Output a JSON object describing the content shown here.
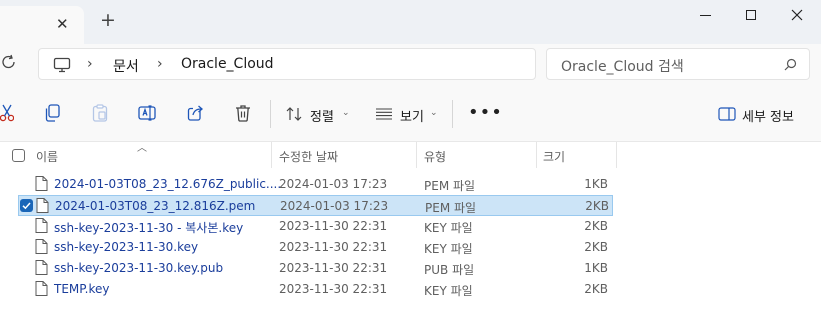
{
  "tabs": {
    "close_glyph": "✕",
    "new_tab_glyph": "+"
  },
  "address": {
    "root_icon": "pc-icon",
    "breadcrumbs": [
      "문서",
      "Oracle_Cloud"
    ],
    "separator": "›"
  },
  "search": {
    "placeholder": "Oracle_Cloud 검색",
    "icon": "search-icon"
  },
  "toolbar": {
    "icons": [
      "cut-icon",
      "copy-icon",
      "paste-icon",
      "rename-icon",
      "share-icon",
      "delete-icon"
    ],
    "sort_label": "정렬",
    "view_label": "보기",
    "more_label": "•••",
    "details_label": "세부 정보"
  },
  "columns": {
    "name": "이름",
    "modified": "수정한 날짜",
    "type": "유형",
    "size": "크기"
  },
  "files": [
    {
      "name": "2024-01-03T08_23_12.676Z_public....",
      "modified": "2024-01-03 17:23",
      "type": "PEM 파일",
      "size": "1KB",
      "selected": false
    },
    {
      "name": "2024-01-03T08_23_12.816Z.pem",
      "modified": "2024-01-03 17:23",
      "type": "PEM 파일",
      "size": "2KB",
      "selected": true
    },
    {
      "name": "ssh-key-2023-11-30 - 복사본.key",
      "modified": "2023-11-30 22:31",
      "type": "KEY 파일",
      "size": "2KB",
      "selected": false
    },
    {
      "name": "ssh-key-2023-11-30.key",
      "modified": "2023-11-30 22:31",
      "type": "KEY 파일",
      "size": "2KB",
      "selected": false
    },
    {
      "name": "ssh-key-2023-11-30.key.pub",
      "modified": "2023-11-30 22:31",
      "type": "PUB 파일",
      "size": "1KB",
      "selected": false
    },
    {
      "name": "TEMP.key",
      "modified": "2023-11-30 22:31",
      "type": "KEY 파일",
      "size": "2KB",
      "selected": false
    }
  ],
  "colors": {
    "selection_bg": "#cce4f7",
    "selection_border": "#99c9ef",
    "checkbox_accent": "#1a66b8",
    "file_name_text": "#1a3d9b"
  }
}
